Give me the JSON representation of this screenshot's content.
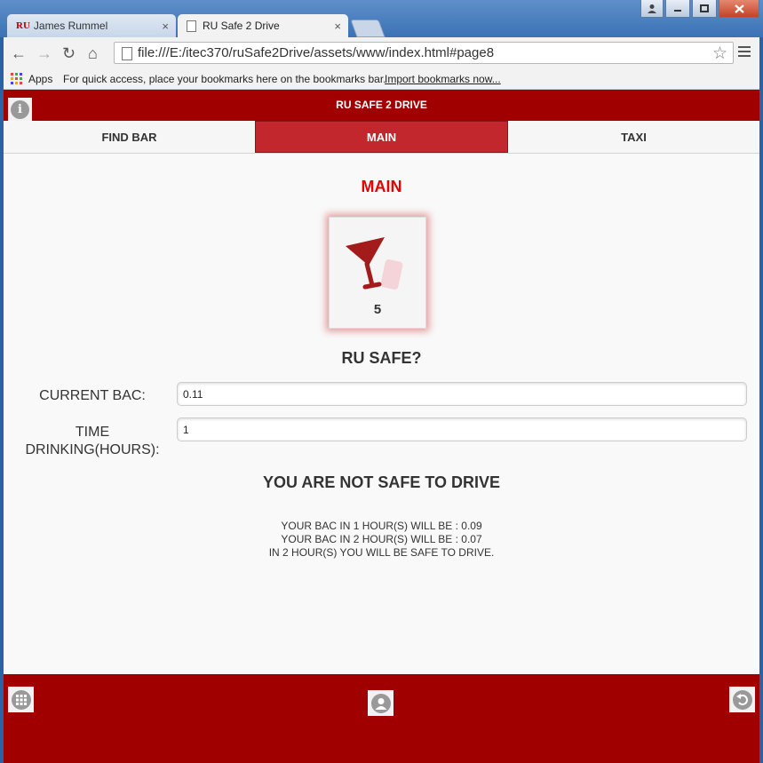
{
  "browser": {
    "tabs": [
      {
        "favicon": "RU",
        "title": "James Rummel",
        "close": "×"
      },
      {
        "title": "RU Safe 2 Drive",
        "close": "×"
      }
    ],
    "url": "file:///E:/itec370/ruSafe2Drive/assets/www/index.html#page8",
    "bookmarks": {
      "apps_label": "Apps",
      "hint": "For quick access, place your bookmarks here on the bookmarks bar.",
      "import_link": "Import bookmarks now..."
    }
  },
  "app": {
    "title": "RU SAFE 2 DRIVE",
    "nav": {
      "find_bar": "FIND BAR",
      "main": "MAIN",
      "taxi": "TAXI"
    },
    "heading": "MAIN",
    "drink_count": "5",
    "ru_safe": "RU SAFE?",
    "bac_label": "CURRENT BAC:",
    "bac_value": "0.11",
    "time_label_1": "TIME",
    "time_label_2": "DRINKING(HOURS):",
    "time_value": "1",
    "status": "YOU ARE NOT SAFE TO DRIVE",
    "results": [
      "YOUR BAC IN 1 HOUR(S) WILL BE : 0.09",
      "YOUR BAC IN 2 HOUR(S) WILL BE : 0.07",
      "IN 2 HOUR(S) YOU WILL BE SAFE TO DRIVE."
    ]
  },
  "colors": {
    "brand_red": "#a00000",
    "nav_active": "#c1272d",
    "heading_red": "#e60000"
  },
  "icons": [
    "info-icon",
    "martini-icon",
    "grid-icon",
    "user-icon",
    "back-icon"
  ]
}
